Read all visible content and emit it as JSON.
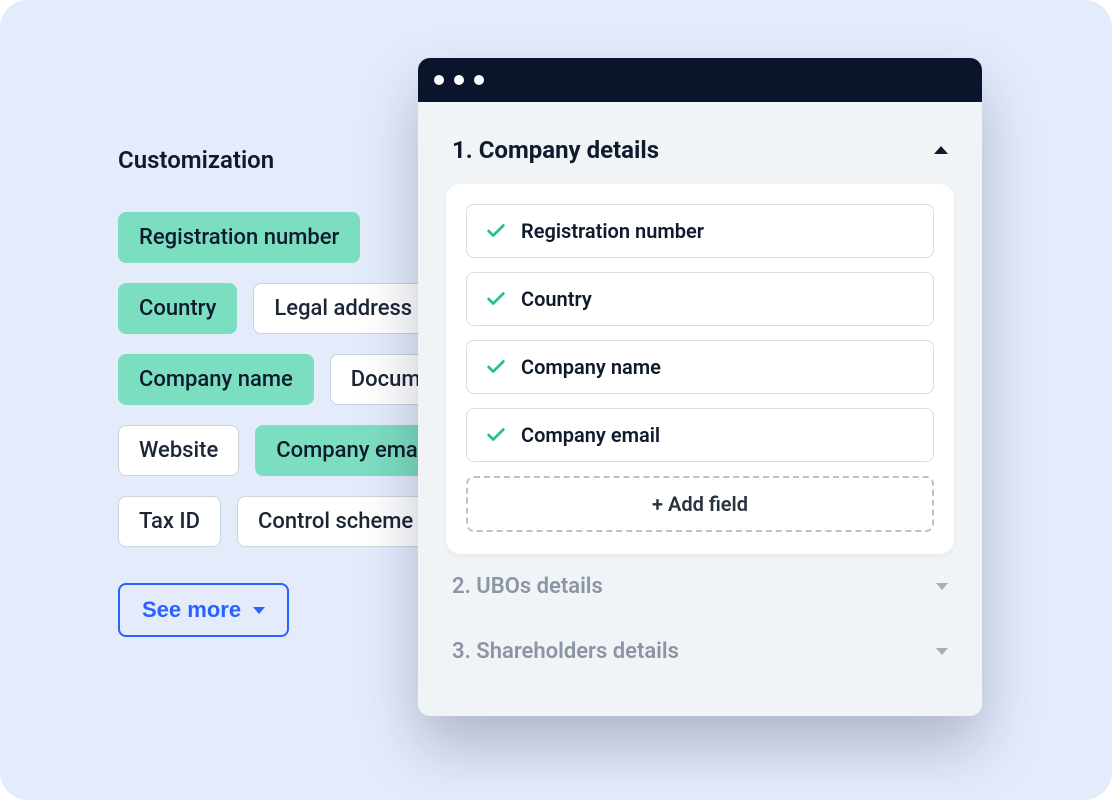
{
  "palette": {
    "title": "Customization",
    "rows": [
      [
        {
          "label": "Registration number",
          "selected": true
        }
      ],
      [
        {
          "label": "Country",
          "selected": true
        },
        {
          "label": "Legal address",
          "selected": false
        }
      ],
      [
        {
          "label": "Company name",
          "selected": true
        },
        {
          "label": "Document",
          "selected": false
        }
      ],
      [
        {
          "label": "Website",
          "selected": false
        },
        {
          "label": "Company email",
          "selected": true
        }
      ],
      [
        {
          "label": "Tax ID",
          "selected": false
        },
        {
          "label": "Control scheme",
          "selected": false
        }
      ]
    ],
    "see_more_label": "See more"
  },
  "modal": {
    "sections": [
      {
        "index": "1.",
        "title": "Company details",
        "expanded": true,
        "fields": [
          {
            "label": "Registration number"
          },
          {
            "label": "Country"
          },
          {
            "label": "Company name"
          },
          {
            "label": "Company email"
          }
        ],
        "add_field_label": "+ Add field"
      },
      {
        "index": "2.",
        "title": "UBOs details",
        "expanded": false
      },
      {
        "index": "3.",
        "title": "Shareholders details",
        "expanded": false
      }
    ]
  }
}
